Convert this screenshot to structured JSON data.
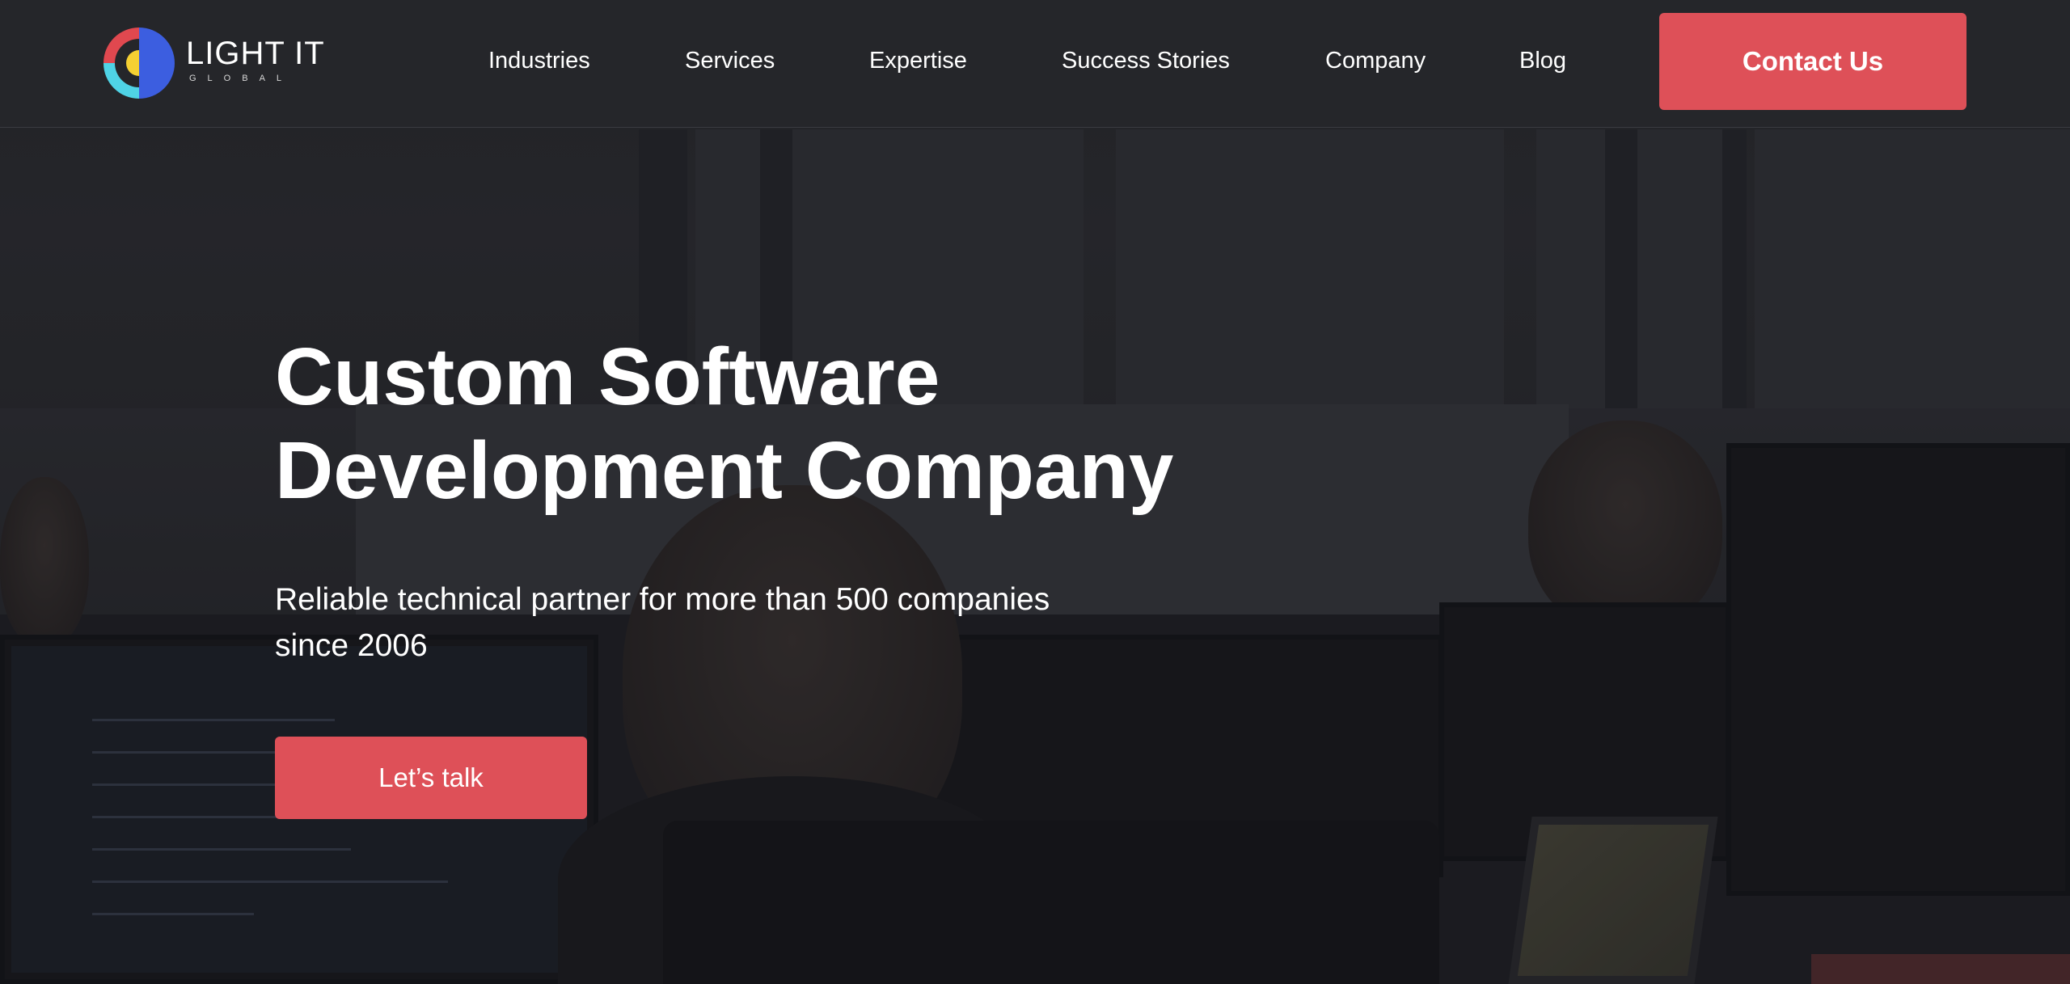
{
  "brand": {
    "name": "LIGHT IT",
    "tagline": "GLOBAL",
    "colors": {
      "accent": "#de5058",
      "logo_red": "#e0484f",
      "logo_blue": "#3c5ee0",
      "logo_cyan": "#4fd3e6",
      "logo_yellow": "#f5d032"
    }
  },
  "nav": {
    "items": [
      {
        "label": "Industries"
      },
      {
        "label": "Services"
      },
      {
        "label": "Expertise"
      },
      {
        "label": "Success Stories"
      },
      {
        "label": "Company"
      },
      {
        "label": "Blog"
      }
    ],
    "contact_label": "Contact Us"
  },
  "hero": {
    "title_line1": "Custom Software",
    "title_line2": "Development Company",
    "subtitle": "Reliable technical partner for more than 500 companies since 2006",
    "cta_label": "Let’s talk"
  }
}
